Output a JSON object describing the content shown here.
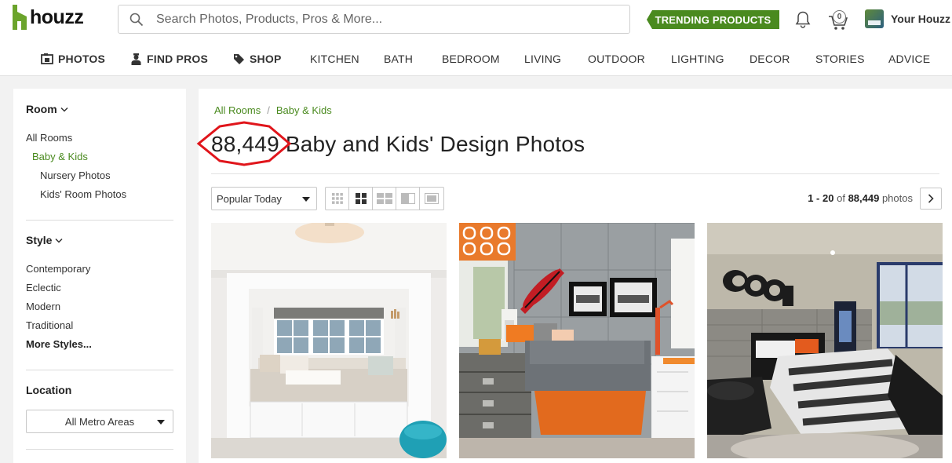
{
  "header": {
    "logo_text": "houzz",
    "search_placeholder": "Search Photos, Products, Pros & More...",
    "trending_label": "TRENDING PRODUCTS",
    "cart_count": "0",
    "account_label": "Your Houzz"
  },
  "nav": {
    "items": [
      {
        "label": "PHOTOS",
        "icon": "photos-icon"
      },
      {
        "label": "FIND PROS",
        "icon": "pro-icon"
      },
      {
        "label": "SHOP",
        "icon": "tag-icon"
      },
      {
        "label": "KITCHEN"
      },
      {
        "label": "BATH"
      },
      {
        "label": "BEDROOM"
      },
      {
        "label": "LIVING"
      },
      {
        "label": "OUTDOOR"
      },
      {
        "label": "LIGHTING"
      },
      {
        "label": "DECOR"
      },
      {
        "label": "STORIES"
      },
      {
        "label": "ADVICE"
      }
    ]
  },
  "sidebar": {
    "room": {
      "heading": "Room",
      "links": [
        "All Rooms",
        "Baby & Kids",
        "Nursery Photos",
        "Kids' Room Photos"
      ]
    },
    "style": {
      "heading": "Style",
      "links": [
        "Contemporary",
        "Eclectic",
        "Modern",
        "Traditional",
        "More Styles..."
      ]
    },
    "location": {
      "heading": "Location",
      "select_value": "All Metro Areas"
    }
  },
  "main": {
    "breadcrumb": [
      "All Rooms",
      "Baby & Kids"
    ],
    "photo_count": "88,449",
    "title_rest": "Baby and Kids' Design Photos",
    "sort_value": "Popular Today",
    "pager": {
      "range": "1 - 20",
      "of": "of",
      "total": "88,449",
      "unit": "photos"
    },
    "photos": [
      {
        "subject": "white window-seat nook with cushions and blue pouf"
      },
      {
        "subject": "gray riveted-wall teen bedroom with orange accents and surfboard"
      },
      {
        "subject": "concrete-wall boys bedroom with COOP letters and striped bedding"
      }
    ]
  },
  "colors": {
    "brand_green": "#4a8a1f",
    "highlight_red": "#e0151b"
  }
}
